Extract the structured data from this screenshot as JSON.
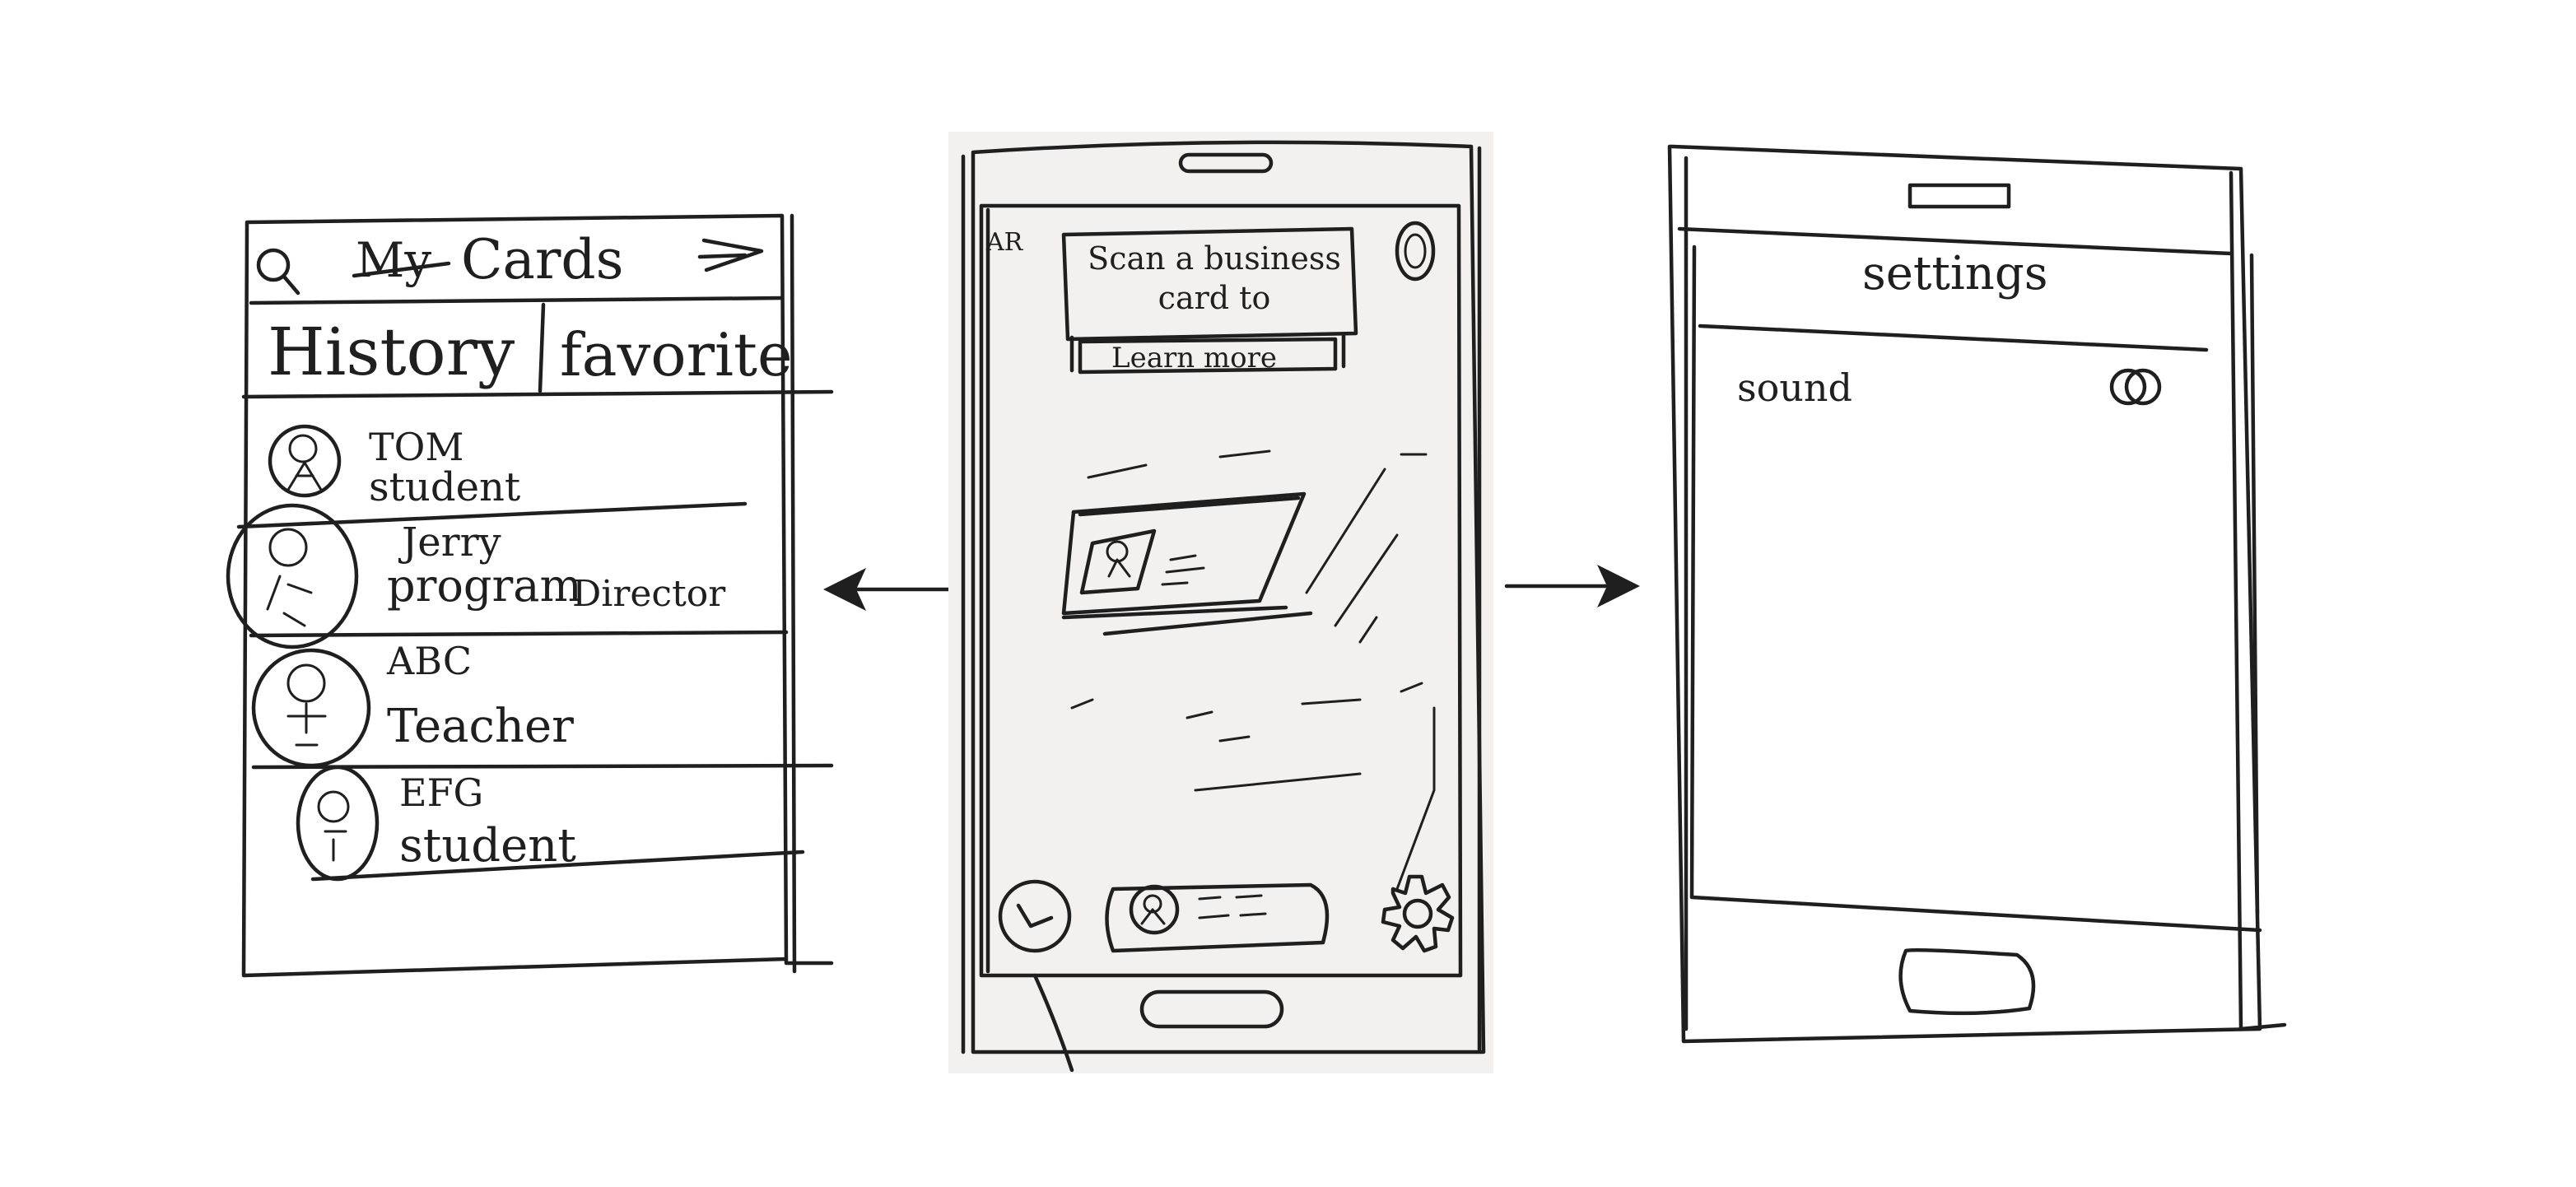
{
  "screens": {
    "cards": {
      "title_struck": "My",
      "title": "Cards",
      "tabs": [
        "History",
        "favorite"
      ],
      "contacts": [
        {
          "name": "TOM",
          "role": "student"
        },
        {
          "name": "Jerry",
          "role": "program",
          "role_extra": "Director"
        },
        {
          "name": "ABC",
          "role": "Teacher"
        },
        {
          "name": "EFG",
          "role": "student"
        }
      ],
      "icons": {
        "search": "search-icon",
        "forward": "arrow-right-icon",
        "avatar": "person-avatar-icon"
      }
    },
    "scan": {
      "brand": "AR",
      "banner_text": "Scan a business card to",
      "learn_more": "Learn more",
      "icons": {
        "history": "history-icon",
        "recent_card": "business-card-icon",
        "settings": "gear-icon",
        "profile": "profile-icon"
      }
    },
    "settings": {
      "title": "settings",
      "rows": [
        {
          "label": "sound",
          "toggle": true
        }
      ]
    }
  },
  "colors": {
    "ink": "#1f1f1f",
    "paper": "#f2f1f0",
    "background": "#ffffff"
  }
}
